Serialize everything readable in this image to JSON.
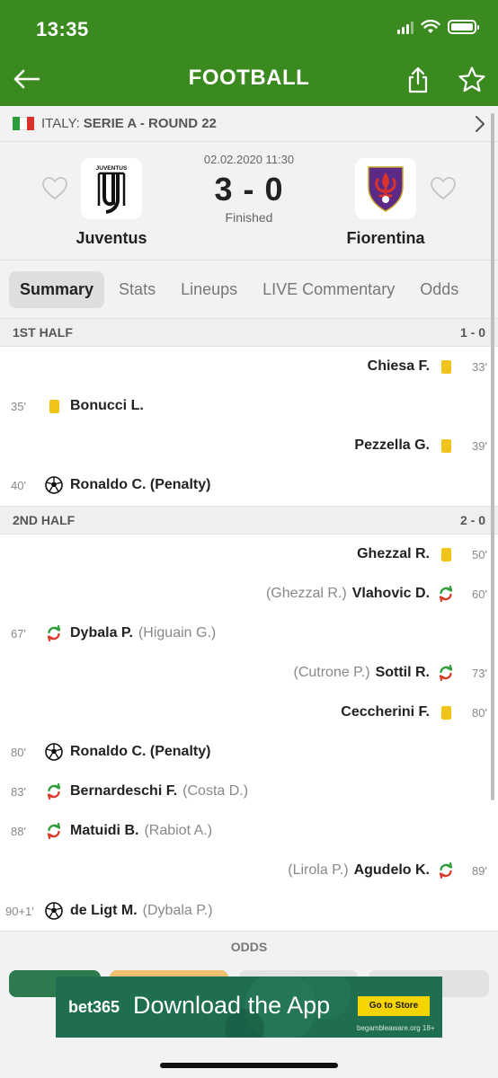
{
  "status_bar": {
    "time": "13:35"
  },
  "header": {
    "title": "FOOTBALL"
  },
  "league": {
    "country": "ITALY:",
    "name": "SERIE A - ROUND 22"
  },
  "match": {
    "datetime": "02.02.2020 11:30",
    "score": "3 - 0",
    "status": "Finished",
    "home_team": "Juventus",
    "home_logo_text": "JUVENTUS",
    "away_team": "Fiorentina"
  },
  "tabs": [
    {
      "label": "Summary",
      "active": true
    },
    {
      "label": "Stats"
    },
    {
      "label": "Lineups"
    },
    {
      "label": "LIVE Commentary"
    },
    {
      "label": "Odds"
    }
  ],
  "summary": {
    "first_half": {
      "label": "1ST HALF",
      "score": "1 - 0",
      "events": [
        {
          "side": "away",
          "minute": "33'",
          "type": "yellow-card",
          "player": "Chiesa F.",
          "detail": ""
        },
        {
          "side": "home",
          "minute": "35'",
          "type": "yellow-card",
          "player": "Bonucci L.",
          "detail": ""
        },
        {
          "side": "away",
          "minute": "39'",
          "type": "yellow-card",
          "player": "Pezzella G.",
          "detail": ""
        },
        {
          "side": "home",
          "minute": "40'",
          "type": "goal",
          "player": "Ronaldo C. (Penalty)",
          "detail": ""
        }
      ]
    },
    "second_half": {
      "label": "2ND HALF",
      "score": "2 - 0",
      "events": [
        {
          "side": "away",
          "minute": "50'",
          "type": "yellow-card",
          "player": "Ghezzal R.",
          "detail": ""
        },
        {
          "side": "away",
          "minute": "60'",
          "type": "substitution",
          "player": "Vlahovic D.",
          "detail": "(Ghezzal R.)"
        },
        {
          "side": "home",
          "minute": "67'",
          "type": "substitution",
          "player": "Dybala P.",
          "detail": "(Higuain G.)"
        },
        {
          "side": "away",
          "minute": "73'",
          "type": "substitution",
          "player": "Sottil R.",
          "detail": "(Cutrone P.)"
        },
        {
          "side": "away",
          "minute": "80'",
          "type": "yellow-card",
          "player": "Ceccherini F.",
          "detail": ""
        },
        {
          "side": "home",
          "minute": "80'",
          "type": "goal",
          "player": "Ronaldo C. (Penalty)",
          "detail": ""
        },
        {
          "side": "home",
          "minute": "83'",
          "type": "substitution",
          "player": "Bernardeschi F.",
          "detail": "(Costa D.)"
        },
        {
          "side": "home",
          "minute": "88'",
          "type": "substitution",
          "player": "Matuidi B.",
          "detail": "(Rabiot A.)"
        },
        {
          "side": "away",
          "minute": "89'",
          "type": "substitution",
          "player": "Agudelo K.",
          "detail": "(Lirola P.)"
        },
        {
          "side": "home",
          "minute": "90+1'",
          "type": "goal",
          "player": "de Ligt M.",
          "detail": "(Dybala P.)"
        }
      ]
    }
  },
  "odds": {
    "label": "ODDS"
  },
  "ad": {
    "brand": "bet365",
    "headline": "Download the App",
    "cta": "Go to Store",
    "footnote": "begambleaware.org 18+"
  },
  "colors": {
    "header_green": "#3b8a1f",
    "yellow_card": "#f0c419",
    "sub_in": "#2e9e3a",
    "sub_out": "#d83a2c",
    "ad_green": "#1f6e50",
    "ad_yellow": "#f5d400"
  }
}
